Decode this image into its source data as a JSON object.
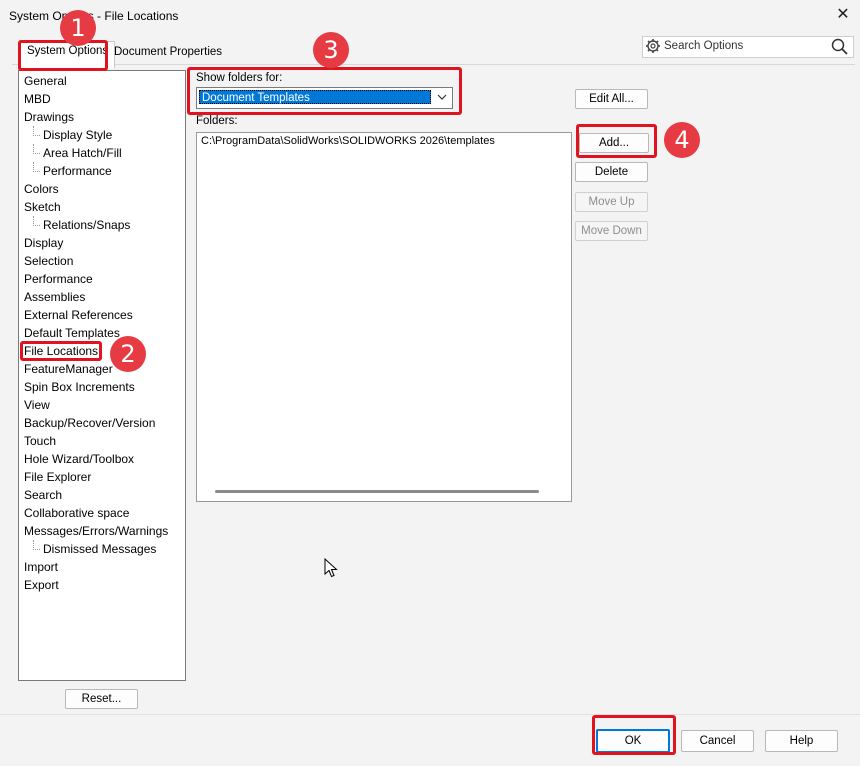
{
  "window": {
    "title": "System Options - File Locations",
    "close_glyph": "✕"
  },
  "tabs": {
    "system_options": "System Options",
    "document_properties": "Document Properties"
  },
  "search": {
    "placeholder": "Search Options"
  },
  "tree": {
    "items": [
      {
        "label": "General",
        "indent": 0
      },
      {
        "label": "MBD",
        "indent": 0
      },
      {
        "label": "Drawings",
        "indent": 0
      },
      {
        "label": "Display Style",
        "indent": 1
      },
      {
        "label": "Area Hatch/Fill",
        "indent": 1
      },
      {
        "label": "Performance",
        "indent": 1
      },
      {
        "label": "Colors",
        "indent": 0
      },
      {
        "label": "Sketch",
        "indent": 0
      },
      {
        "label": "Relations/Snaps",
        "indent": 1
      },
      {
        "label": "Display",
        "indent": 0
      },
      {
        "label": "Selection",
        "indent": 0
      },
      {
        "label": "Performance",
        "indent": 0
      },
      {
        "label": "Assemblies",
        "indent": 0
      },
      {
        "label": "External References",
        "indent": 0
      },
      {
        "label": "Default Templates",
        "indent": 0
      },
      {
        "label": "File Locations",
        "indent": 0,
        "selected": true
      },
      {
        "label": "FeatureManager",
        "indent": 0
      },
      {
        "label": "Spin Box Increments",
        "indent": 0
      },
      {
        "label": "View",
        "indent": 0
      },
      {
        "label": "Backup/Recover/Version",
        "indent": 0
      },
      {
        "label": "Touch",
        "indent": 0
      },
      {
        "label": "Hole Wizard/Toolbox",
        "indent": 0
      },
      {
        "label": "File Explorer",
        "indent": 0
      },
      {
        "label": "Search",
        "indent": 0
      },
      {
        "label": "Collaborative space",
        "indent": 0
      },
      {
        "label": "Messages/Errors/Warnings",
        "indent": 0
      },
      {
        "label": "Dismissed Messages",
        "indent": 1
      },
      {
        "label": "Import",
        "indent": 0
      },
      {
        "label": "Export",
        "indent": 0
      }
    ]
  },
  "reset_label": "Reset...",
  "show_folders": {
    "label": "Show folders for:",
    "selected": "Document Templates"
  },
  "folders": {
    "label": "Folders:",
    "paths": [
      "C:\\ProgramData\\SolidWorks\\SOLIDWORKS 2026\\templates"
    ]
  },
  "side_buttons": {
    "edit_all": "Edit All...",
    "add": "Add...",
    "delete": "Delete",
    "move_up": "Move Up",
    "move_down": "Move Down"
  },
  "footer": {
    "ok": "OK",
    "cancel": "Cancel",
    "help": "Help"
  },
  "annotations": {
    "badge_1": "1",
    "badge_2": "2",
    "badge_3": "3",
    "badge_4": "4"
  },
  "colors": {
    "highlight_red": "#e0131f",
    "badge_red": "#e63b42",
    "selection_blue": "#0078d7"
  }
}
